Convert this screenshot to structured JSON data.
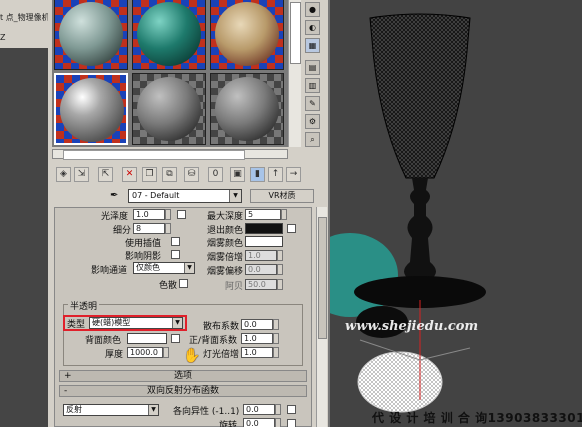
{
  "left_panel": {
    "text1": "t 点_物理像机",
    "text2": "Z"
  },
  "material_editor": {
    "material_name": "07 - Default",
    "material_type_button": "VR材质",
    "rollout": {
      "glossiness_label": "光泽度",
      "glossiness_value": "1.0",
      "subdivs_label": "细分",
      "subdivs_value": "8",
      "use_interp_label": "使用插值",
      "affect_shadows_label": "影响阴影",
      "affect_channel_label": "影响通道",
      "affect_channel_value": "仅颜色",
      "max_depth_label": "最大深度",
      "max_depth_value": "5",
      "exit_color_label": "退出颜色",
      "fog_color_label": "烟雾颜色",
      "fog_multiplier_label": "烟雾倍增",
      "fog_multiplier_value": "1.0",
      "fog_bias_label": "烟雾偏移",
      "fog_bias_value": "0.0",
      "dispersion_label": "色散",
      "abbe_label": "阿贝",
      "abbe_value": "50.0"
    },
    "translucency": {
      "group_label": "半透明",
      "type_label": "类型",
      "type_value": "硬(蜡)模型",
      "back_color_label": "背面颜色",
      "thickness_label": "厚度",
      "thickness_value": "1000.0",
      "scatter_coeff_label": "散布系数",
      "scatter_coeff_value": "0.0",
      "fwd_back_coeff_label": "正/背面系数",
      "fwd_back_coeff_value": "1.0",
      "light_multiplier_label": "灯光倍增",
      "light_multiplier_value": "1.0"
    },
    "options_rollout": "选项",
    "brdf_rollout": "双向反射分布函数",
    "brdf": {
      "type_value": "反射",
      "anisotropy_label": "各向异性 (-1..1)",
      "anisotropy_value": "0.0",
      "rotation_label": "旋转",
      "rotation_value": "0.0"
    }
  },
  "viewport": {
    "watermark": "www.shejiedu.com"
  },
  "footer": {
    "text": "代 设 计 培 训 合 询13903833301"
  },
  "colors": {
    "panel_bg": "#d4d0c8",
    "viewport_bg": "#434343",
    "highlight_red": "#e0202a"
  }
}
